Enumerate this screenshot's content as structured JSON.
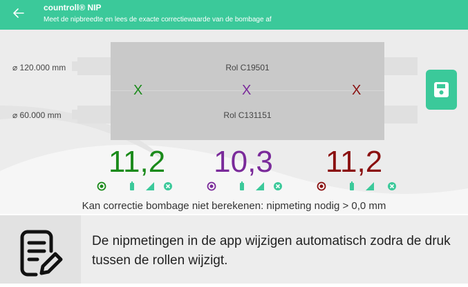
{
  "appbar": {
    "title": "countroll® NIP",
    "subtitle": "Meet de nipbreedte en lees de exacte correctiewaarde van de bombage af"
  },
  "diagram": {
    "top_diameter": "⌀ 120.000 mm",
    "bottom_diameter": "⌀ 60.000 mm",
    "top_roll": "Rol C19501",
    "bottom_roll": "Rol C131151"
  },
  "measurements": [
    {
      "x_label": "X",
      "value": "11,2",
      "color": "#1a8a1a"
    },
    {
      "x_label": "X",
      "value": "10,3",
      "color": "#7a2a9a"
    },
    {
      "x_label": "X",
      "value": "11,2",
      "color": "#8a1010"
    }
  ],
  "status": "Kan correctie bombage niet berekenen: nipmeting nodig > 0,0 mm",
  "note": {
    "icon": "document-edit-icon",
    "text": "De nipmetingen in de app wijzigen automatisch zodra de druk tussen de rollen wijzigt."
  },
  "colors": {
    "accent": "#3bc99a",
    "measure_icon": "#3bc99a"
  }
}
